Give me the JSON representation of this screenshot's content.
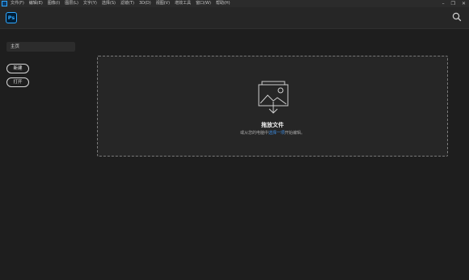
{
  "menubar": {
    "items": [
      "文件(F)",
      "编辑(E)",
      "图像(I)",
      "图层(L)",
      "文字(Y)",
      "选择(S)",
      "滤镜(T)",
      "3D(D)",
      "视图(V)",
      "增效工具",
      "窗口(W)",
      "帮助(H)"
    ],
    "window_controls": [
      "–",
      "❐",
      "✕"
    ]
  },
  "header": {
    "app_logo": "Ps",
    "search_icon": "search-icon"
  },
  "sidebar": {
    "home": "主页",
    "new_button": "新建",
    "open_button": "打开"
  },
  "dropzone": {
    "icon": "image-drop-icon",
    "title": "拖放文件",
    "subtitle_before": "或从您的电脑中",
    "subtitle_link": "选择一项",
    "subtitle_after": "开始编辑。"
  },
  "colors": {
    "background": "#1e1e1e",
    "accent": "#31a8ff",
    "link": "#3d8fe8"
  }
}
